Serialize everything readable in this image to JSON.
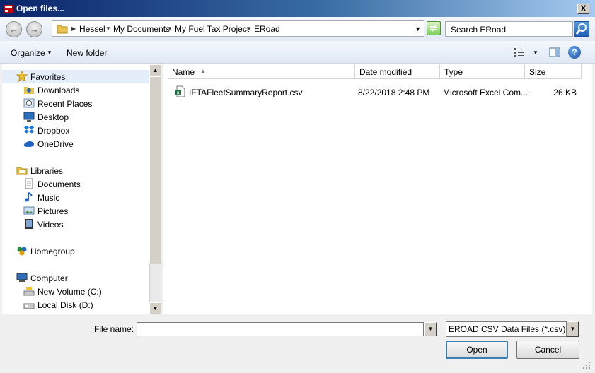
{
  "window": {
    "title": "Open files...",
    "close_glyph": "X"
  },
  "address": {
    "crumbs": [
      "Hessel",
      "My Documents",
      "My Fuel Tax Project",
      "ERoad"
    ],
    "search_placeholder": "Search ERoad"
  },
  "toolbar": {
    "organize_label": "Organize",
    "new_folder_label": "New folder",
    "help_glyph": "?"
  },
  "nav": {
    "items": [
      {
        "label": "Favorites",
        "icon": "star-icon",
        "group": true
      },
      {
        "label": "Downloads",
        "icon": "downloads-folder-icon"
      },
      {
        "label": "Recent Places",
        "icon": "recent-places-icon"
      },
      {
        "label": "Desktop",
        "icon": "desktop-icon"
      },
      {
        "label": "Dropbox",
        "icon": "dropbox-icon"
      },
      {
        "label": "OneDrive",
        "icon": "onedrive-icon"
      },
      {
        "label": "Libraries",
        "icon": "libraries-icon",
        "group": true
      },
      {
        "label": "Documents",
        "icon": "documents-icon"
      },
      {
        "label": "Music",
        "icon": "music-icon"
      },
      {
        "label": "Pictures",
        "icon": "pictures-icon"
      },
      {
        "label": "Videos",
        "icon": "videos-icon"
      },
      {
        "label": "Homegroup",
        "icon": "homegroup-icon",
        "group": true
      },
      {
        "label": "Computer",
        "icon": "computer-icon",
        "group": true
      },
      {
        "label": "New Volume (C:)",
        "icon": "drive-c-icon"
      },
      {
        "label": "Local Disk (D:)",
        "icon": "drive-d-icon"
      }
    ]
  },
  "columns": {
    "name": "Name",
    "date": "Date modified",
    "type": "Type",
    "size": "Size"
  },
  "files": [
    {
      "name": "IFTAFleetSummaryReport.csv",
      "date": "8/22/2018 2:48 PM",
      "type": "Microsoft Excel Com...",
      "size": "26 KB"
    }
  ],
  "footer": {
    "file_name_label": "File name:",
    "file_name_value": "",
    "filter_selected": "EROAD CSV Data Files (*.csv)",
    "open_label": "Open",
    "cancel_label": "Cancel"
  },
  "colors": {
    "accent": "#3c7fb1",
    "selection": "#e4eefb"
  }
}
